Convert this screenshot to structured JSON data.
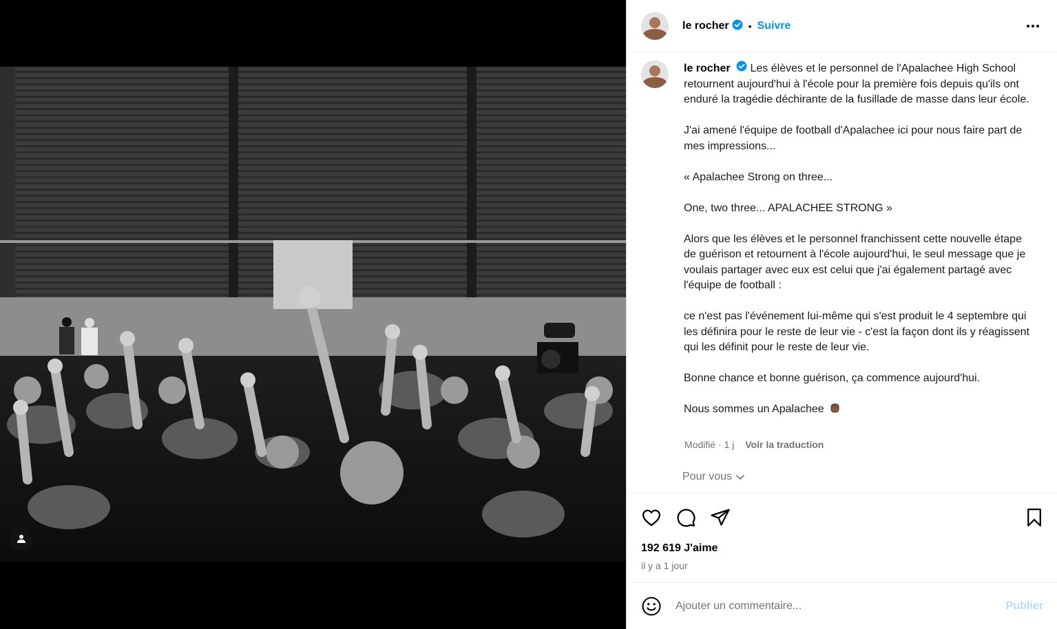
{
  "media": {
    "tag_icon": "user-tag-icon"
  },
  "header": {
    "username": "le rocher",
    "verified_icon": "verified-badge-icon",
    "separator": "•",
    "follow_label": "Suivre",
    "more_icon": "more-options-icon"
  },
  "caption": {
    "username": "le rocher",
    "paragraphs": [
      "Les élèves et le personnel de l'Apalachee High School retournent aujourd'hui à l'école pour la première fois depuis qu'ils ont enduré la tragédie déchirante de la fusillade de masse dans leur école.",
      "J'ai amené l'équipe de football d'Apalachee ici pour nous faire part de mes impressions...",
      "« Apalachee Strong on three...",
      "One, two three... APALACHEE STRONG »",
      "Alors que les élèves et le personnel franchissent cette nouvelle étape de guérison et retournent à l'école aujourd'hui, le seul message que je voulais partager avec eux est celui que j'ai également partagé avec l'équipe de football :",
      "ce n'est pas l'événement lui-même qui s'est produit le 4 septembre qui les définira pour le reste de leur vie - c'est la façon dont ils y réagissent qui les définit pour le reste de leur vie.",
      "Bonne chance et bonne guérison, ça commence aujourd'hui.",
      "Nous sommes un Apalachee"
    ],
    "emoji_icon": "raised-fist-emoji-icon",
    "meta": "Modifié · 1 j",
    "translate_label": "Voir la traduction",
    "for_you_label": "Pour vous"
  },
  "actions": {
    "like_icon": "heart-icon",
    "comment_icon": "comment-icon",
    "share_icon": "share-icon",
    "save_icon": "bookmark-icon",
    "likes_text": "192 619 J'aime",
    "time_text": "il y a 1 jour"
  },
  "comment": {
    "emoji_icon": "emoji-icon",
    "placeholder": "Ajouter un commentaire...",
    "publish_label": "Publier"
  },
  "colors": {
    "accent": "#0095f6",
    "publish_disabled": "#b3dbff",
    "secondary_text": "#737373",
    "border": "#dbdbdb"
  }
}
